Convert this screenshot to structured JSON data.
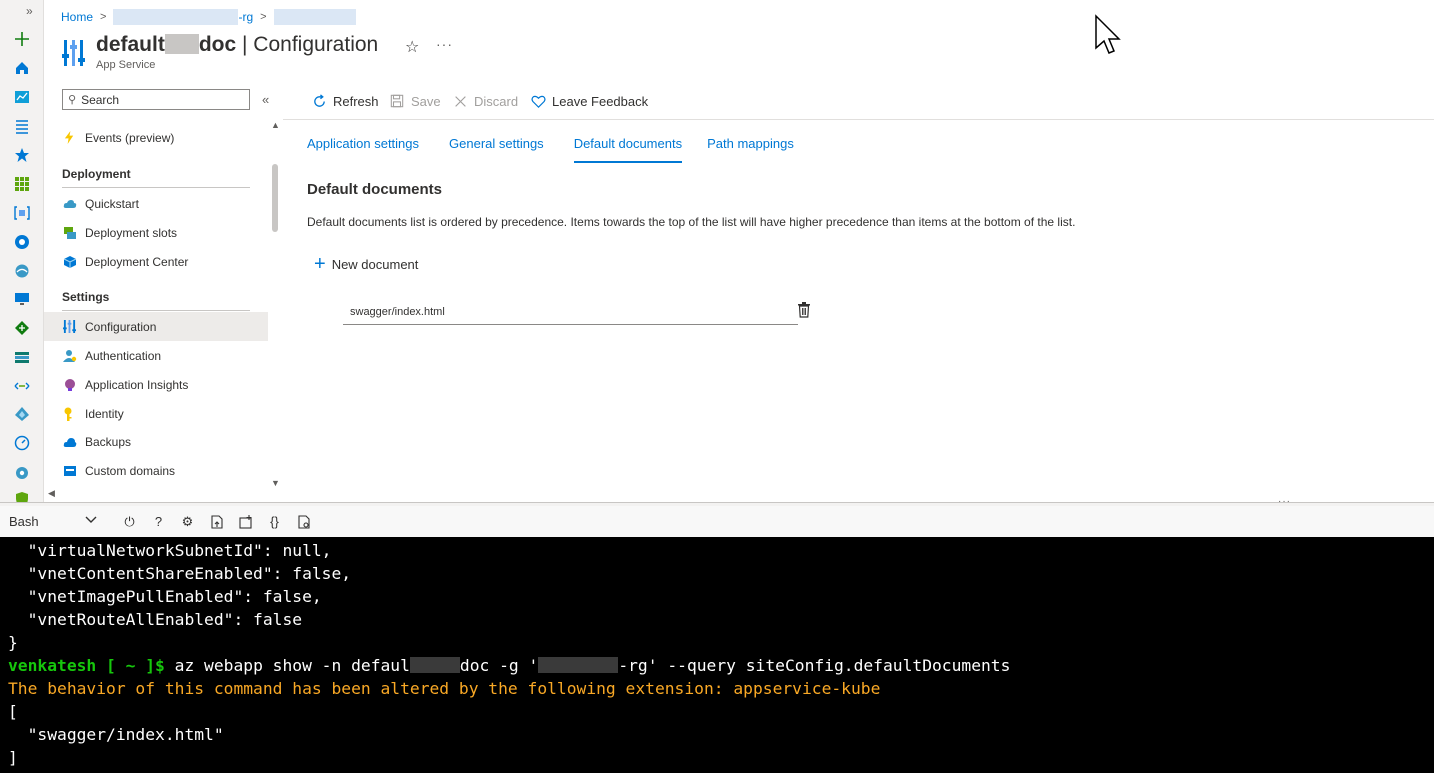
{
  "breadcrumb": {
    "home": "Home",
    "resource_group_suffix": "-rg"
  },
  "header": {
    "title_prefix": "default",
    "title_suffix": "doc",
    "title_section": " | Configuration",
    "subtitle": "App Service"
  },
  "menu": {
    "search_placeholder": "Search",
    "events": "Events (preview)",
    "deployment_header": "Deployment",
    "quickstart": "Quickstart",
    "deployment_slots": "Deployment slots",
    "deployment_center": "Deployment Center",
    "settings_header": "Settings",
    "configuration": "Configuration",
    "authentication": "Authentication",
    "application_insights": "Application Insights",
    "identity": "Identity",
    "backups": "Backups",
    "custom_domains": "Custom domains"
  },
  "toolbar": {
    "refresh": "Refresh",
    "save": "Save",
    "discard": "Discard",
    "feedback": "Leave Feedback"
  },
  "tabs": {
    "app_settings": "Application settings",
    "general_settings": "General settings",
    "default_documents": "Default documents",
    "path_mappings": "Path mappings"
  },
  "content": {
    "section_title": "Default documents",
    "description": "Default documents list is ordered by precedence. Items towards the top of the list will have higher precedence than items at the bottom of the list.",
    "new_document": "New document",
    "documents": [
      "swagger/index.html"
    ]
  },
  "shell": {
    "selected": "Bash"
  },
  "terminal": {
    "line1": "  \"virtualNetworkSubnetId\": null,",
    "line2": "  \"vnetContentShareEnabled\": false,",
    "line3": "  \"vnetImagePullEnabled\": false,",
    "line4": "  \"vnetRouteAllEnabled\": false",
    "line5": "}",
    "prompt": "venkatesh [ ~ ]$",
    "cmd_a": " az webapp show -n defaul",
    "cmd_b": "doc -g '",
    "cmd_c": "-rg' --query siteConfig.defaultDocuments",
    "warning": "The behavior of this command has been altered by the following extension: appservice-kube",
    "line8": "[",
    "line9": "  \"swagger/index.html\"",
    "line10": "]"
  },
  "colors": {
    "accent": "#0078d4",
    "terminal_bg": "#000000",
    "prompt_green": "#16c60c",
    "warning_yellow": "#f9a825"
  }
}
